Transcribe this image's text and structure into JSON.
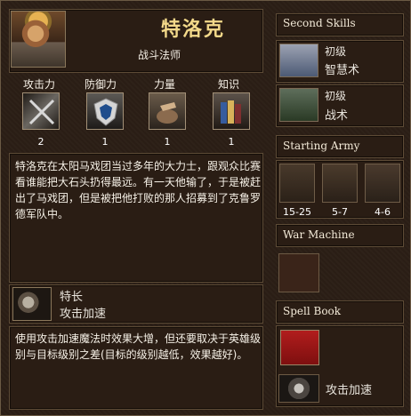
{
  "hero": {
    "name": "特洛克",
    "class": "战斗法师",
    "portrait_icon": "hero-portrait-icon"
  },
  "stats": [
    {
      "label": "攻击力",
      "value": "2",
      "icon": "crossed-swords-icon"
    },
    {
      "label": "防御力",
      "value": "1",
      "icon": "shield-icon"
    },
    {
      "label": "力量",
      "value": "1",
      "icon": "power-rock-icon"
    },
    {
      "label": "知识",
      "value": "1",
      "icon": "books-icon"
    }
  ],
  "description": "特洛克在太阳马戏团当过多年的大力士，跟观众比赛看谁能把大石头扔得最远。有一天他输了，于是被赶出了马戏团，但是被把他打败的那人招募到了克鲁罗德军队中。",
  "specialty": {
    "title": "特长",
    "name": "攻击加速",
    "description": "使用攻击加速魔法时效果大增，但还要取决于英雄级别与目标级别之差(目标的级别越低，效果越好)。"
  },
  "sections": {
    "second_skills": "Second Skills",
    "starting_army": "Starting Army",
    "war_machine": "War Machine",
    "spell_book": "Spell Book"
  },
  "skills": [
    {
      "level": "初级",
      "name": "智慧术",
      "icon": "scroll-icon"
    },
    {
      "level": "初级",
      "name": "战术",
      "icon": "banner-icon"
    }
  ],
  "army": [
    {
      "count": "15-25",
      "icon": "goblin-warrior-icon"
    },
    {
      "count": "5-7",
      "icon": "wolf-rider-icon"
    },
    {
      "count": "4-6",
      "icon": "orc-icon"
    }
  ],
  "spellbook": {
    "spell_name": "攻击加速",
    "book_icon": "spellbook-icon",
    "spell_icon": "haste-icon"
  },
  "colors": {
    "panel": "#2a1d14",
    "gold_text": "#f3d98a",
    "text": "#f3ead8"
  }
}
